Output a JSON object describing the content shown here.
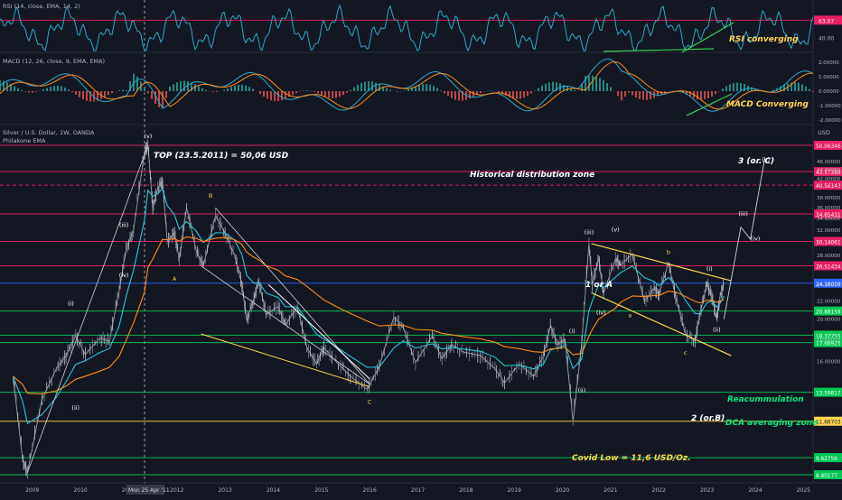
{
  "chart_data": [
    {
      "type": "line",
      "pane": "rsi",
      "indicator_label": "RSI (14, close, EMA, 14, 2)",
      "ticks": [
        "63.07",
        "40.00"
      ],
      "annotation": "RSI converging",
      "colors": {
        "rsi": "#2aa9c9",
        "divergence": "#34d058",
        "label": "#ffd54f"
      }
    },
    {
      "type": "line",
      "pane": "macd",
      "indicator_label": "MACD (12, 26, close, 9, EMA, EMA)",
      "ticks": [
        "2.00000",
        "1.00000",
        "0.00000",
        "-1.00000",
        "-2.00000"
      ],
      "annotation": "MACD Converging",
      "colors": {
        "macd": "#2aa9c9",
        "signal": "#ff8c1a",
        "hist_pos": "#26a69a",
        "hist_neg": "#ef5350"
      }
    },
    {
      "type": "line",
      "pane": "price",
      "symbol": "Silver / U.S. Dollar, 1W, OANDA",
      "sub": "Philakone EMA",
      "unit": "USD",
      "x_ticks": [
        "2009",
        "2010",
        "2011",
        "2012",
        "2013",
        "2014",
        "2015",
        "2016",
        "2017",
        "2018",
        "2019",
        "2020",
        "2021",
        "2022",
        "2023",
        "2024",
        "2025"
      ],
      "cursor_date": "Mon 25 Apr '11",
      "y_ticks": [
        "46.00000",
        "44.00000",
        "42.00000",
        "38.00000",
        "36.00000",
        "34.00000",
        "32.00000",
        "28.00000",
        "24.00000",
        "22.00000",
        "20.00000",
        "18.00000",
        "16.00000"
      ],
      "series": [
        {
          "points": [
            [
              2008.6,
              14.8
            ],
            [
              2008.8,
              9.5
            ],
            [
              2008.9,
              8.9
            ],
            [
              2009.2,
              13.1
            ],
            [
              2009.5,
              15.4
            ],
            [
              2009.7,
              16.5
            ],
            [
              2009.9,
              18.3
            ],
            [
              2010.1,
              16.6
            ],
            [
              2010.4,
              18.1
            ],
            [
              2010.6,
              17.8
            ],
            [
              2010.8,
              23.2
            ],
            [
              2010.95,
              28.9
            ],
            [
              2011.1,
              32.0
            ],
            [
              2011.33,
              48.4
            ],
            [
              2011.4,
              50.06
            ],
            [
              2011.5,
              36.0
            ],
            [
              2011.6,
              39.8
            ],
            [
              2011.7,
              41.6
            ],
            [
              2011.8,
              30.2
            ],
            [
              2011.95,
              31.5
            ],
            [
              2012.05,
              27.4
            ],
            [
              2012.2,
              36.0
            ],
            [
              2012.4,
              28.8
            ],
            [
              2012.55,
              26.5
            ],
            [
              2012.8,
              34.5
            ],
            [
              2013.0,
              31.5
            ],
            [
              2013.2,
              28.0
            ],
            [
              2013.35,
              24.0
            ],
            [
              2013.45,
              19.8
            ],
            [
              2013.6,
              22.3
            ],
            [
              2013.7,
              24.5
            ],
            [
              2013.85,
              20.5
            ],
            [
              2014.1,
              21.4
            ],
            [
              2014.25,
              19.4
            ],
            [
              2014.5,
              21.3
            ],
            [
              2014.7,
              17.2
            ],
            [
              2014.9,
              15.8
            ],
            [
              2015.05,
              17.2
            ],
            [
              2015.3,
              16.0
            ],
            [
              2015.6,
              14.8
            ],
            [
              2015.95,
              13.8
            ],
            [
              2016.2,
              15.6
            ],
            [
              2016.5,
              20.2
            ],
            [
              2016.7,
              19.1
            ],
            [
              2016.95,
              15.9
            ],
            [
              2017.3,
              18.3
            ],
            [
              2017.5,
              16.2
            ],
            [
              2017.7,
              17.5
            ],
            [
              2017.95,
              16.8
            ],
            [
              2018.3,
              16.5
            ],
            [
              2018.6,
              15.4
            ],
            [
              2018.8,
              14.3
            ],
            [
              2019.1,
              15.8
            ],
            [
              2019.4,
              14.8
            ],
            [
              2019.6,
              16.4
            ],
            [
              2019.75,
              19.3
            ],
            [
              2019.9,
              17.5
            ],
            [
              2020.05,
              18.0
            ],
            [
              2020.22,
              11.65
            ],
            [
              2020.4,
              17.6
            ],
            [
              2020.55,
              29.8
            ],
            [
              2020.62,
              24.0
            ],
            [
              2020.75,
              27.6
            ],
            [
              2020.85,
              22.9
            ],
            [
              2021.1,
              27.5
            ],
            [
              2021.2,
              26.6
            ],
            [
              2021.45,
              28.2
            ],
            [
              2021.7,
              22.0
            ],
            [
              2021.9,
              23.5
            ],
            [
              2022.0,
              22.8
            ],
            [
              2022.2,
              26.9
            ],
            [
              2022.35,
              22.5
            ],
            [
              2022.55,
              18.5
            ],
            [
              2022.75,
              17.8
            ],
            [
              2022.85,
              20.5
            ],
            [
              2023.0,
              24.1
            ],
            [
              2023.1,
              22.5
            ],
            [
              2023.2,
              20.0
            ],
            [
              2023.27,
              22.5
            ],
            [
              2023.35,
              24.1
            ]
          ]
        }
      ],
      "price_levels": [
        {
          "label": "50.06346",
          "value": 50.06,
          "color": "#e91e63"
        },
        {
          "label": "43.57288",
          "value": 43.57,
          "color": "#e91e63"
        },
        {
          "label": "40.56143",
          "value": 40.56,
          "color": "#e91e63"
        },
        {
          "label": "34.85431",
          "value": 34.85,
          "color": "#e91e63"
        },
        {
          "label": "30.14061",
          "value": 30.14,
          "color": "#e91e63"
        },
        {
          "label": "26.51434",
          "value": 26.51,
          "color": "#e91e63"
        },
        {
          "label": "24.18009",
          "value": 24.18,
          "color": "#2962ff"
        },
        {
          "label": "20.88158",
          "value": 20.88,
          "color": "#00c853"
        },
        {
          "label": "18.37755",
          "value": 18.38,
          "color": "#00c853"
        },
        {
          "label": "17.66925",
          "value": 17.67,
          "color": "#00c853"
        },
        {
          "label": "13.59817",
          "value": 13.6,
          "color": "#00c853"
        },
        {
          "label": "11.66703",
          "value": 11.67,
          "color": "#ffd54f"
        },
        {
          "label": "9.62756",
          "value": 9.63,
          "color": "#00c853"
        },
        {
          "label": "8.80177",
          "value": 8.8,
          "color": "#00c853"
        }
      ],
      "annotations": {
        "top": "TOP (23.5.2011) = 50,06 USD",
        "zone": "Historical distribution zone",
        "covid": "Covid Low = 11,6 USD/Oz.",
        "reacc": "Reacummulation",
        "dca": "DCA averaging zone",
        "wave3": "3 (or. C)",
        "wave2": "2 (or.B)",
        "wave1": "1 or A",
        "waves_left": [
          "(i)",
          "(ii)",
          "(iii)",
          "(iv)",
          "(v)",
          "A",
          "B",
          "C"
        ],
        "waves_right": [
          "(i)",
          "(ii)",
          "(iii)",
          "(iv)",
          "(v)",
          "a",
          "b",
          "c",
          "(i)",
          "(ii)",
          "(iii)",
          "(iv)",
          "(v)"
        ]
      }
    }
  ]
}
